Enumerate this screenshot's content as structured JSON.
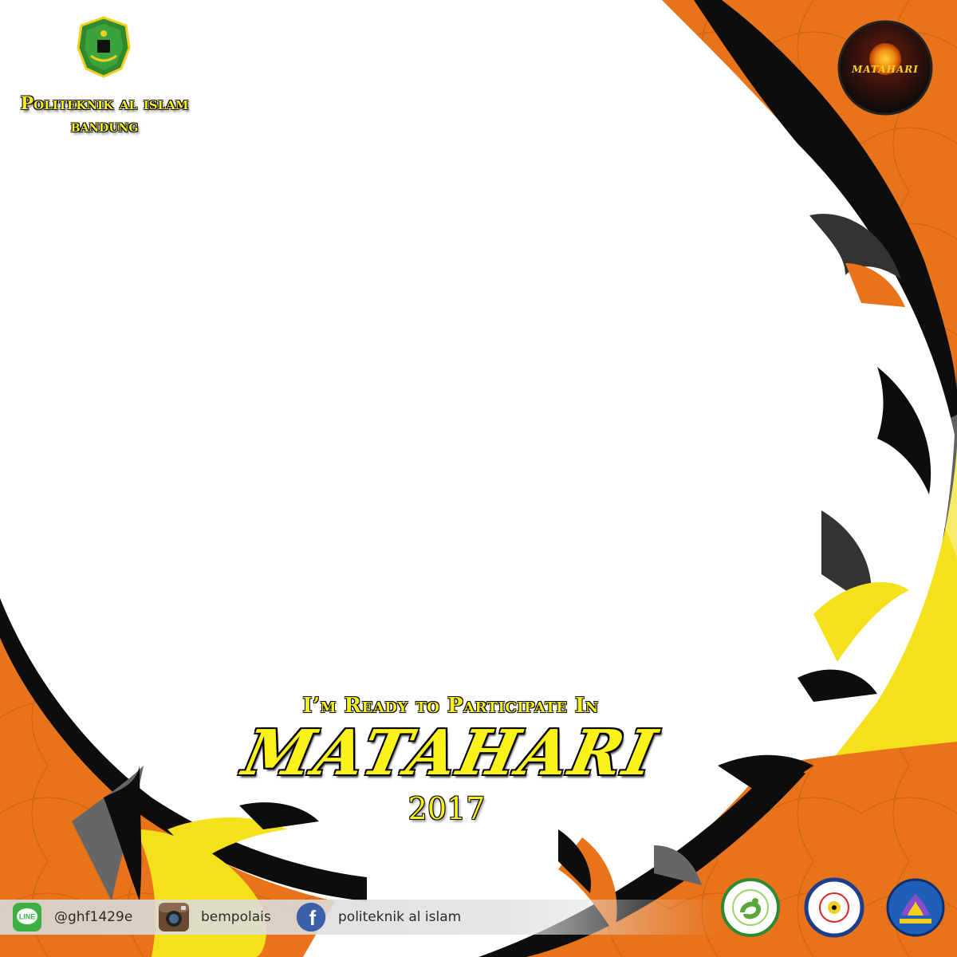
{
  "header": {
    "campus_line1": "Politeknik al islam",
    "campus_line2": "bandung",
    "event_logo_text": "MATAHARI"
  },
  "main": {
    "ready_text": "I’m Ready  to Participate In",
    "title": "MATAHARI",
    "year": "2017"
  },
  "footer": {
    "line_icon_label": "LINE",
    "line_id": "@ghf1429e",
    "instagram_handle": "bempolais",
    "facebook_page": "politeknik al islam",
    "facebook_icon_glyph": "f"
  },
  "colors": {
    "orange": "#e8731a",
    "yellow": "#f4e11b",
    "black": "#0d0d0d",
    "gray": "#5e5e5e",
    "title_yellow": "#fbf21a"
  },
  "icons": [
    "campus-crest-icon",
    "matahari-sun-icon",
    "line-icon",
    "instagram-icon",
    "facebook-icon",
    "himatera-logo-icon",
    "radiology-logo-icon",
    "himaars-logo-icon"
  ]
}
